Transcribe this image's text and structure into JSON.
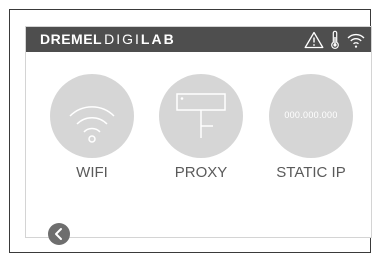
{
  "brand": {
    "part1": "DREMEL",
    "part2": "DIGI",
    "part3": "LAB"
  },
  "status_icons": [
    "warning-icon",
    "thermometer-icon",
    "wifi-signal-icon"
  ],
  "options": [
    {
      "label": "WIFI",
      "icon": "wifi-icon"
    },
    {
      "label": "PROXY",
      "icon": "proxy-icon"
    },
    {
      "label": "STATIC IP",
      "icon": "ip-address-icon",
      "value": "000.000.000"
    }
  ],
  "back_icon": "back-arrow-icon",
  "colors": {
    "topbar": "#4e4e4e",
    "circle": "#d6d6d6",
    "label": "#5a5a5a",
    "back_button": "#6e6e6e"
  }
}
